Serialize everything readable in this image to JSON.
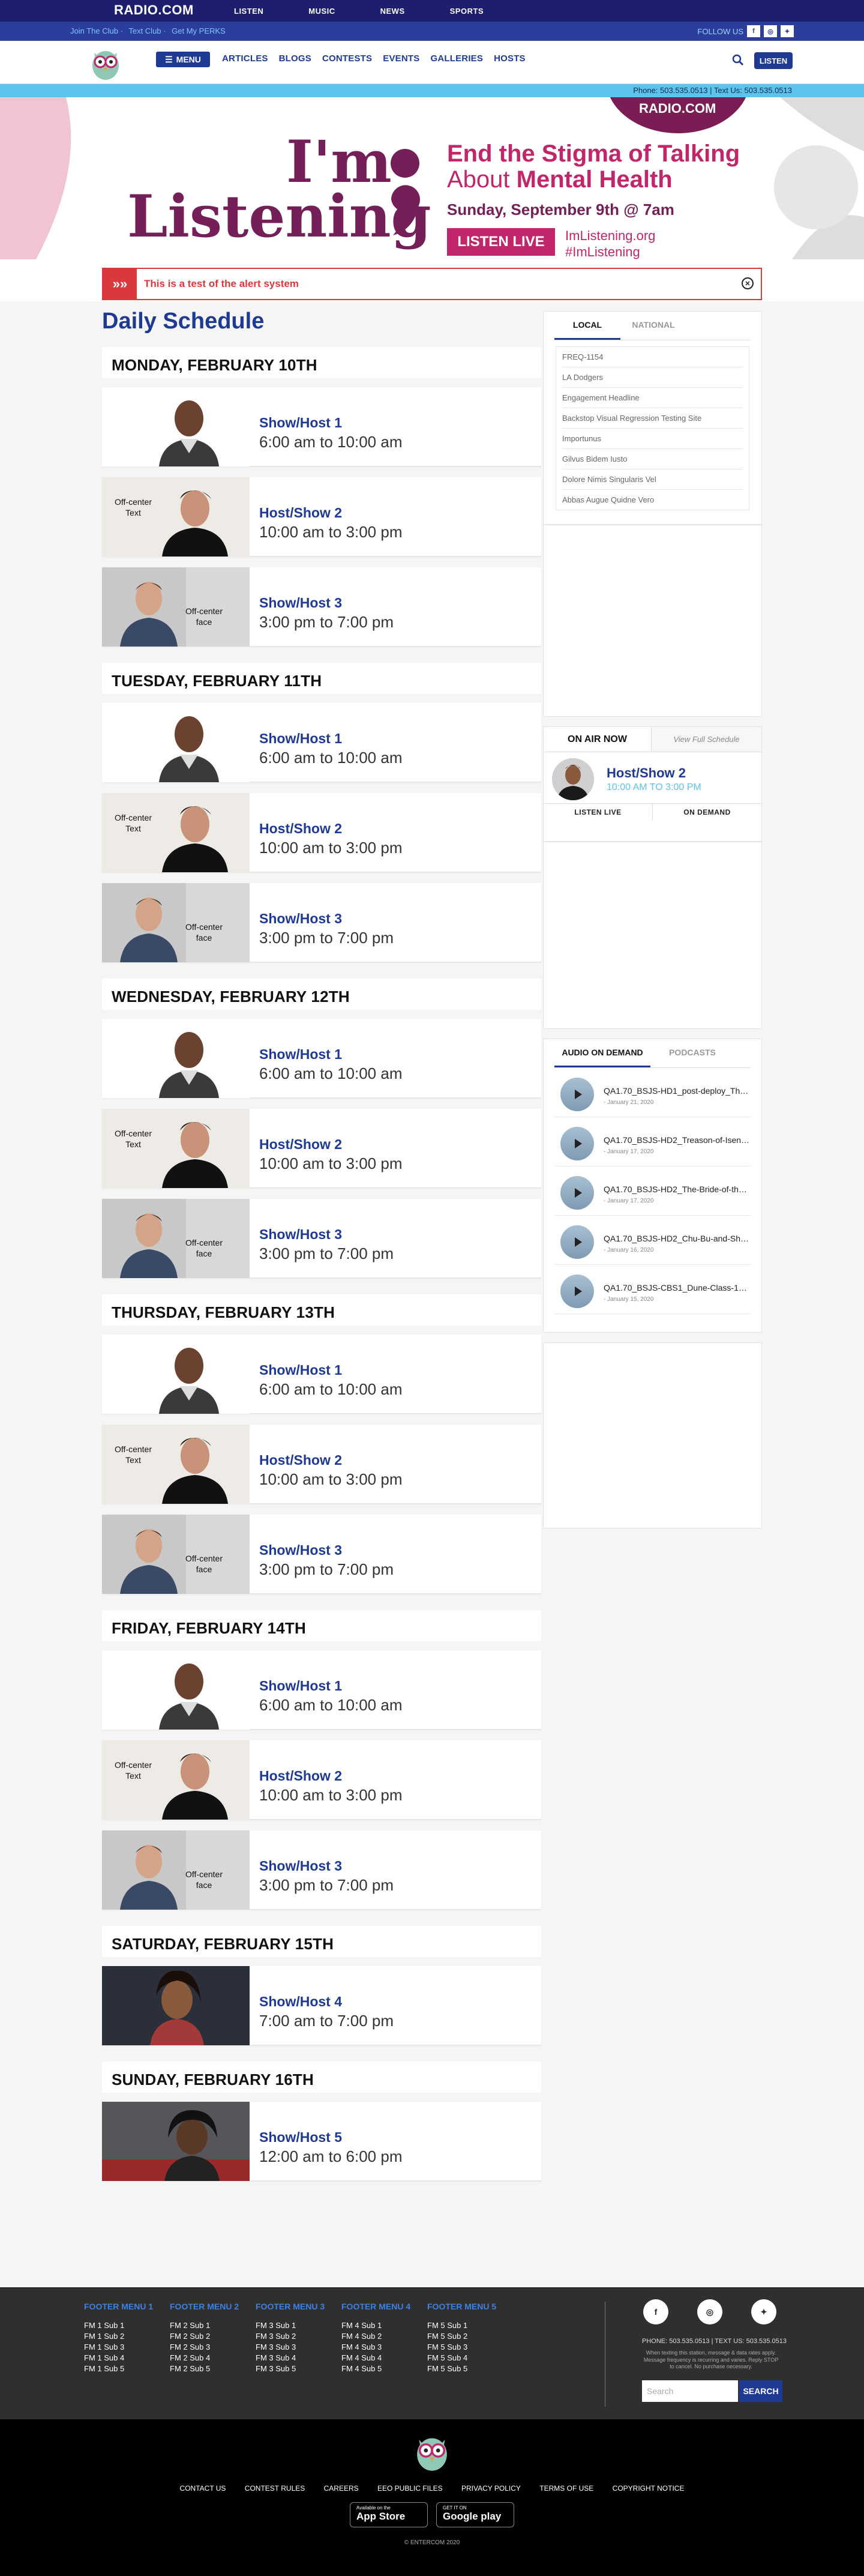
{
  "topnav": {
    "logo": "RADIO.COM",
    "items": [
      "LISTEN",
      "MUSIC",
      "NEWS",
      "SPORTS"
    ]
  },
  "subbar": {
    "links": [
      "Join The Club",
      "Text Club",
      "Get My PERKS"
    ],
    "follow_label": "FOLLOW US",
    "social": [
      "f",
      "ig",
      "tw"
    ]
  },
  "mainnav": {
    "menu_label": "MENU",
    "items": [
      "ARTICLES",
      "BLOGS",
      "CONTESTS",
      "EVENTS",
      "GALLERIES",
      "HOSTS"
    ],
    "listen_label": "LISTEN"
  },
  "phonebar": {
    "text": "Phone: 503.535.0513 | Text Us: 503.535.0513"
  },
  "hero": {
    "badge": "RADIO.COM",
    "title_line1": "I'm",
    "title_line2": "Listening",
    "end_line1": "End the Stigma of Talking",
    "end_line2a": "About ",
    "end_line2b": "Mental Health",
    "date": "Sunday, September 9th @ 7am",
    "live_btn": "LISTEN LIVE",
    "tag1": "ImListening.org",
    "tag2": "#ImListening"
  },
  "alert": {
    "message": "This is a test of the alert system"
  },
  "schedule": {
    "title": "Daily Schedule",
    "days": [
      {
        "label": "MONDAY, FEBRUARY 10TH",
        "shows": [
          {
            "name": "Show/Host 1",
            "time": "6:00 am to 10:00 am"
          },
          {
            "name": "Host/Show 2",
            "time": "10:00 am to 3:00 pm"
          },
          {
            "name": "Show/Host 3",
            "time": "3:00 pm to 7:00 pm"
          }
        ]
      },
      {
        "label": "TUESDAY, FEBRUARY 11TH",
        "shows": [
          {
            "name": "Show/Host 1",
            "time": "6:00 am to 10:00 am"
          },
          {
            "name": "Host/Show 2",
            "time": "10:00 am to 3:00 pm"
          },
          {
            "name": "Show/Host 3",
            "time": "3:00 pm to 7:00 pm"
          }
        ]
      },
      {
        "label": "WEDNESDAY, FEBRUARY 12TH",
        "shows": [
          {
            "name": "Show/Host 1",
            "time": "6:00 am to 10:00 am"
          },
          {
            "name": "Host/Show 2",
            "time": "10:00 am to 3:00 pm"
          },
          {
            "name": "Show/Host 3",
            "time": "3:00 pm to 7:00 pm"
          }
        ]
      },
      {
        "label": "THURSDAY, FEBRUARY 13TH",
        "shows": [
          {
            "name": "Show/Host 1",
            "time": "6:00 am to 10:00 am"
          },
          {
            "name": "Host/Show 2",
            "time": "10:00 am to 3:00 pm"
          },
          {
            "name": "Show/Host 3",
            "time": "3:00 pm to 7:00 pm"
          }
        ]
      },
      {
        "label": "FRIDAY, FEBRUARY 14TH",
        "shows": [
          {
            "name": "Show/Host 1",
            "time": "6:00 am to 10:00 am"
          },
          {
            "name": "Host/Show 2",
            "time": "10:00 am to 3:00 pm"
          },
          {
            "name": "Show/Host 3",
            "time": "3:00 pm to 7:00 pm"
          }
        ]
      },
      {
        "label": "SATURDAY, FEBRUARY 15TH",
        "shows": [
          {
            "name": "Show/Host 4",
            "time": "7:00 am to 7:00 pm"
          }
        ]
      },
      {
        "label": "SUNDAY, FEBRUARY 16TH",
        "shows": [
          {
            "name": "Show/Host 5",
            "time": "12:00 am to 6:00 pm"
          }
        ]
      }
    ]
  },
  "photo_labels": {
    "text": "Off-center Text",
    "face": "Off-center face"
  },
  "sidebar": {
    "links_tabs": [
      "LOCAL",
      "NATIONAL"
    ],
    "links": [
      "FREQ-1154",
      "LA Dodgers",
      "Engagement Headline",
      "Backstop Visual Regression Testing Site",
      "Importunus",
      "Gilvus Bidem Iusto",
      "Dolore Nimis Singularis Vel",
      "Abbas Augue Quidne Vero"
    ],
    "on_air": {
      "title": "ON AIR NOW",
      "view": "View Full Schedule",
      "show": "Host/Show 2",
      "time": "10:00 AM TO 3:00 PM",
      "listen": "LISTEN LIVE",
      "demand": "ON DEMAND"
    },
    "audio_tabs": [
      "AUDIO ON DEMAND",
      "PODCASTS"
    ],
    "audio": [
      {
        "title": "QA1.70_BSJS-HD1_post-deploy_The-Ma...",
        "date": "- January 21, 2020"
      },
      {
        "title": "QA1.70_BSJS-HD2_Treason-of-Isengard...",
        "date": "- January 17, 2020"
      },
      {
        "title": "QA1.70_BSJS-HD2_The-Bride-of-the-Mo...",
        "date": "- January 17, 2020"
      },
      {
        "title": "QA1.70_BSJS-HD2_Chu-Bu-and-Sheemer...",
        "date": "- January 16, 2020"
      },
      {
        "title": "QA1.70_BSJS-CBS1_Dune-Class-1_Fut...",
        "date": "- January 15, 2020"
      }
    ]
  },
  "footer": {
    "menus": [
      {
        "title": "FOOTER MENU 1",
        "items": [
          "FM 1 Sub 1",
          "FM 1 Sub 2",
          "FM 1 Sub 3",
          "FM 1 Sub 4",
          "FM 1 Sub 5"
        ]
      },
      {
        "title": "FOOTER MENU 2",
        "items": [
          "FM 2 Sub 1",
          "FM 2 Sub 2",
          "FM 2 Sub 3",
          "FM 2 Sub 4",
          "FM 2 Sub 5"
        ]
      },
      {
        "title": "FOOTER MENU 3",
        "items": [
          "FM 3 Sub 1",
          "FM 3 Sub 2",
          "FM 3 Sub 3",
          "FM 3 Sub 4",
          "FM 3 Sub 5"
        ]
      },
      {
        "title": "FOOTER MENU 4",
        "items": [
          "FM 4 Sub 1",
          "FM 4 Sub 2",
          "FM 4 Sub 3",
          "FM 4 Sub 4",
          "FM 4 Sub 5"
        ]
      },
      {
        "title": "FOOTER MENU 5",
        "items": [
          "FM 5 Sub 1",
          "FM 5 Sub 2",
          "FM 5 Sub 3",
          "FM 5 Sub 4",
          "FM 5 Sub 5"
        ]
      }
    ],
    "social": [
      "f",
      "ig",
      "tw"
    ],
    "phone": "PHONE: 503.535.0513 | TEXT US: 503.535.0513",
    "note": "When texting this station, message & data rates apply. Message frequency is recurring and varies. Reply STOP to cancel. No purchase necessary.",
    "search_placeholder": "Search",
    "search_btn": "SEARCH"
  },
  "bottom": {
    "links": [
      "CONTACT US",
      "CONTEST RULES",
      "CAREERS",
      "EEO PUBLIC FILES",
      "PRIVACY POLICY",
      "TERMS OF USE",
      "COPYRIGHT NOTICE"
    ],
    "app_store": {
      "small": "Available on the",
      "big": "App Store"
    },
    "google": {
      "small": "GET IT ON",
      "big": "Google play"
    },
    "copyright": "© ENTERCOM 2020"
  },
  "colors": {
    "navy": "#1e1e6e",
    "brand_blue": "#1f3a93",
    "accent_cyan": "#5cc3ec",
    "magenta": "#c1266a",
    "plum": "#741f57",
    "alert_red": "#d9383c"
  }
}
